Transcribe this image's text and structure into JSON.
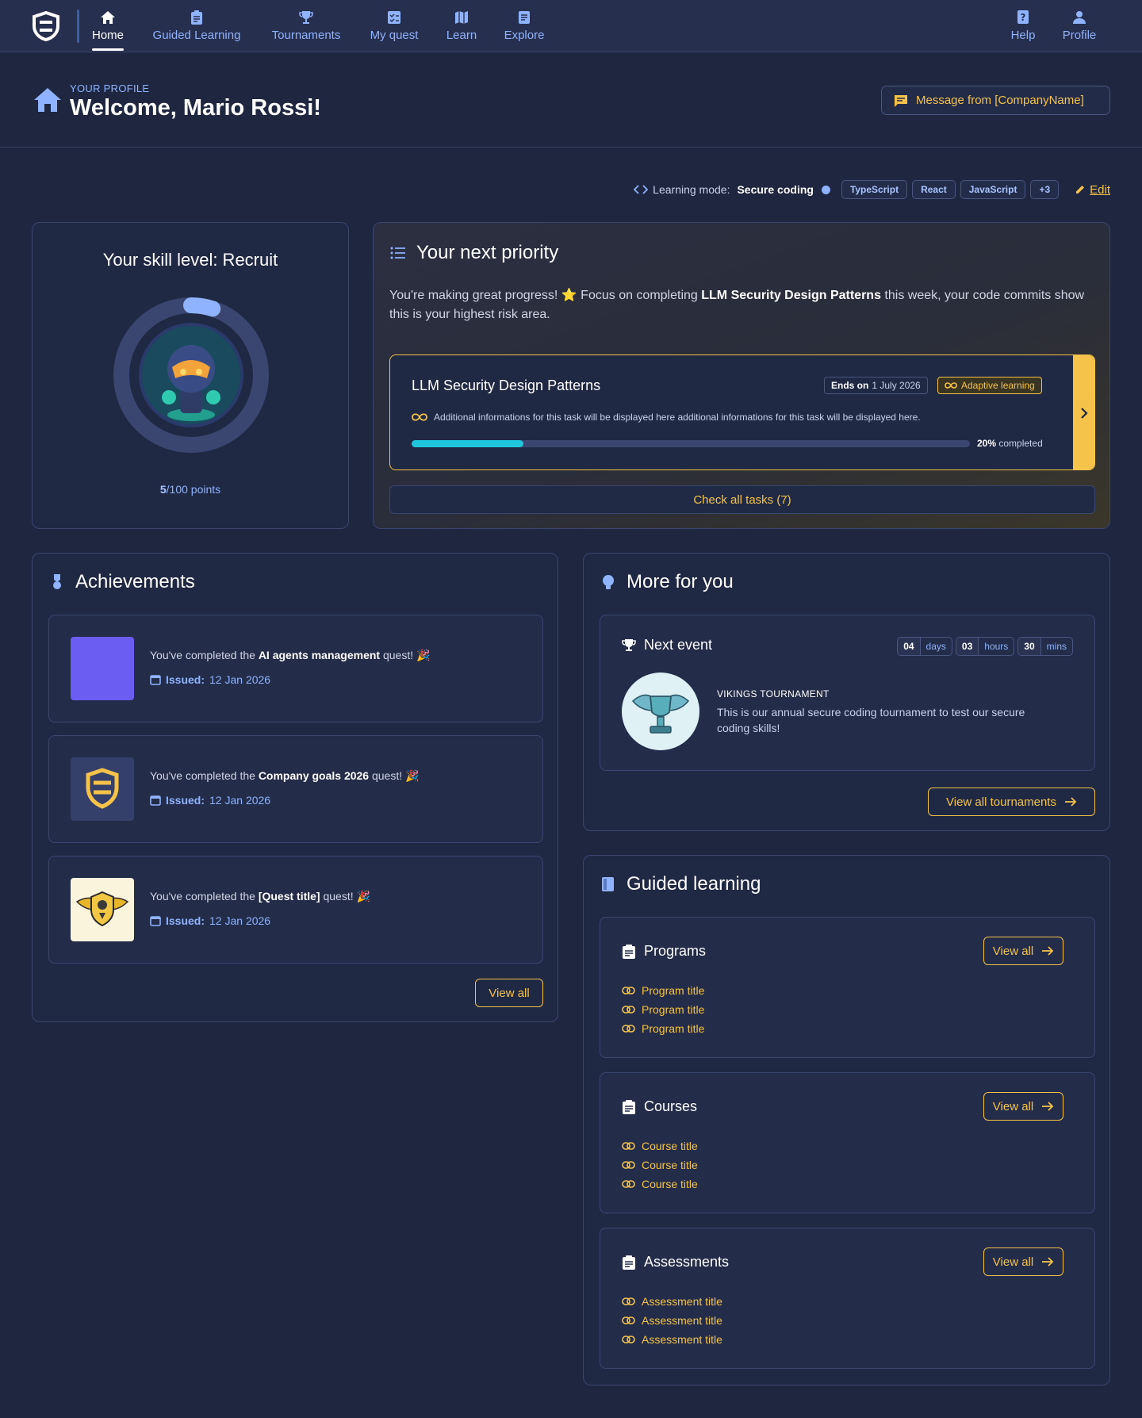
{
  "nav": {
    "items": [
      {
        "label": "Home",
        "icon": "home-icon"
      },
      {
        "label": "Guided Learning",
        "icon": "clipboard-icon"
      },
      {
        "label": "Tournaments",
        "icon": "trophy-icon"
      },
      {
        "label": "My quest",
        "icon": "checklist-icon"
      },
      {
        "label": "Learn",
        "icon": "map-icon"
      },
      {
        "label": "Explore",
        "icon": "document-icon"
      }
    ],
    "right": [
      {
        "label": "Help",
        "icon": "help-icon"
      },
      {
        "label": "Profile",
        "icon": "person-icon"
      }
    ]
  },
  "header": {
    "eyebrow": "YOUR PROFILE",
    "welcome": "Welcome, Mario Rossi!",
    "message_button": "Message from [CompanyName]"
  },
  "learning_mode": {
    "label": "Learning mode:",
    "value": "Secure coding",
    "tags": [
      "TypeScript",
      "React",
      "JavaScript",
      "+3"
    ],
    "edit": "Edit"
  },
  "skill": {
    "title": "Your skill level: Recruit",
    "points": "5",
    "points_suffix": "/100 points",
    "progress_fraction": 0.05
  },
  "priority": {
    "title": "Your next priority",
    "text_before": "You're making great progress! ⭐ Focus on completing ",
    "text_bold": "LLM Security Design Patterns",
    "text_after": " this week, your code commits show this is your highest risk area.",
    "task": {
      "title": "LLM Security Design Patterns",
      "ends_label": "Ends on",
      "ends_date": "1 July 2026",
      "badge": "Adaptive learning",
      "info": "Additional informations for this task will be displayed here additional informations for this task will be displayed here.",
      "progress_percent": 20,
      "progress_value": "20%",
      "progress_suffix": "completed"
    },
    "check_all": "Check all tasks (7)"
  },
  "achievements": {
    "title": "Achievements",
    "items": [
      {
        "before": "You've completed the ",
        "bold": "AI agents management",
        "after": " quest! 🎉",
        "issued_label": "Issued:",
        "date": "12 Jan 2026",
        "thumb_color": "#6b5cf2"
      },
      {
        "before": "You've completed the ",
        "bold": "Company goals 2026",
        "after": " quest! 🎉",
        "issued_label": "Issued:",
        "date": "12 Jan 2026",
        "thumb_color": "#34406a"
      },
      {
        "before": "You've completed the ",
        "bold": "[Quest title]",
        "after": " quest! 🎉",
        "issued_label": "Issued:",
        "date": "12 Jan 2026",
        "thumb_color": "#fbf4dc"
      }
    ],
    "view_all": "View all"
  },
  "more": {
    "title": "More for you",
    "event_title": "Next event",
    "countdown": [
      {
        "num": "04",
        "unit": "days"
      },
      {
        "num": "03",
        "unit": "hours"
      },
      {
        "num": "30",
        "unit": "mins"
      }
    ],
    "event_name": "VIKINGS TOURNAMENT",
    "event_desc": "This is our annual secure coding tournament to test our secure coding skills!",
    "view_all": "View all tournaments"
  },
  "guided": {
    "title": "Guided learning",
    "sections": [
      {
        "title": "Programs",
        "view_all": "View all",
        "links": [
          "Program title",
          "Program title",
          "Program title"
        ]
      },
      {
        "title": "Courses",
        "view_all": "View all",
        "links": [
          "Course title",
          "Course title",
          "Course title"
        ]
      },
      {
        "title": "Assessments",
        "view_all": "View all",
        "links": [
          "Assessment title",
          "Assessment title",
          "Assessment title"
        ]
      }
    ]
  },
  "colors": {
    "accent": "#f6c34a",
    "link_blue": "#8fb3ff",
    "progress": "#1fc6dc",
    "background": "#1e2640"
  }
}
